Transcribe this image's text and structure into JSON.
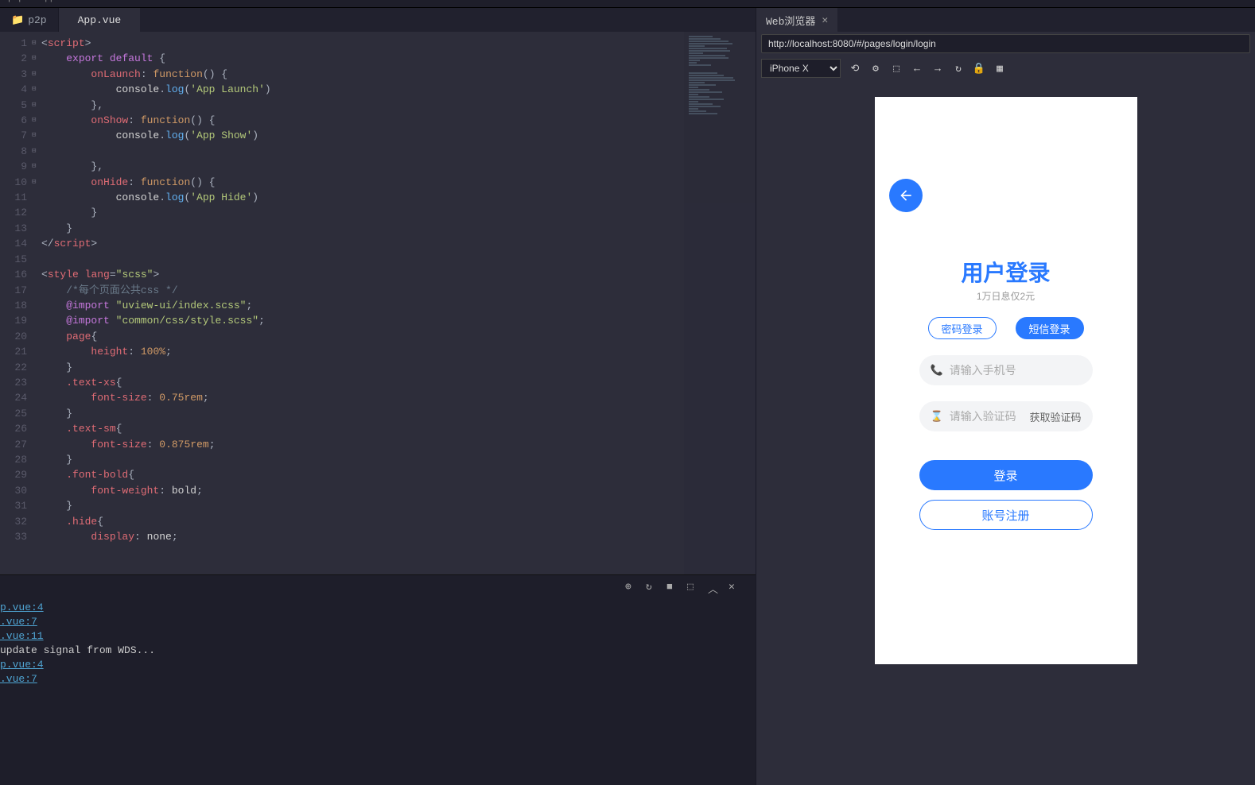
{
  "breadcrumb": {
    "folder": "p2p",
    "file": "App.vue"
  },
  "tabs": {
    "folder": "p2p",
    "file": "App.vue"
  },
  "code_lines": [
    "<span class='tk-pn'>&lt;</span><span class='tk-tag'>script</span><span class='tk-pn'>&gt;</span>",
    "    <span class='tk-key'>export</span> <span class='tk-key'>default</span> <span class='tk-pn'>{</span>",
    "        <span class='tk-attr'>onLaunch</span><span class='tk-pn'>:</span> <span class='tk-fn'>function</span><span class='tk-pn'>() {</span>",
    "            <span class='tk-val'>console</span><span class='tk-pn'>.</span><span class='tk-name'>log</span><span class='tk-pn'>(</span><span class='tk-str'>'App Launch'</span><span class='tk-pn'>)</span>",
    "        <span class='tk-pn'>},</span>",
    "        <span class='tk-attr'>onShow</span><span class='tk-pn'>:</span> <span class='tk-fn'>function</span><span class='tk-pn'>() {</span>",
    "            <span class='tk-val'>console</span><span class='tk-pn'>.</span><span class='tk-name'>log</span><span class='tk-pn'>(</span><span class='tk-str'>'App Show'</span><span class='tk-pn'>)</span>",
    "",
    "        <span class='tk-pn'>},</span>",
    "        <span class='tk-attr'>onHide</span><span class='tk-pn'>:</span> <span class='tk-fn'>function</span><span class='tk-pn'>() {</span>",
    "            <span class='tk-val'>console</span><span class='tk-pn'>.</span><span class='tk-name'>log</span><span class='tk-pn'>(</span><span class='tk-str'>'App Hide'</span><span class='tk-pn'>)</span>",
    "        <span class='tk-pn'>}</span>",
    "    <span class='tk-pn'>}</span>",
    "<span class='tk-pn'>&lt;/</span><span class='tk-tag'>script</span><span class='tk-pn'>&gt;</span>",
    "",
    "<span class='tk-pn'>&lt;</span><span class='tk-tag'>style</span> <span class='tk-attr'>lang</span><span class='tk-pn'>=</span><span class='tk-str'>\"scss\"</span><span class='tk-pn'>&gt;</span>",
    "    <span class='tk-cm'>/*每个页面公共css */</span>",
    "    <span class='tk-key'>@import</span> <span class='tk-str'>\"uview-ui/index.scss\"</span><span class='tk-pn'>;</span>",
    "    <span class='tk-key'>@import</span> <span class='tk-str'>\"common/css/style.scss\"</span><span class='tk-pn'>;</span>",
    "    <span class='tk-prop'>page</span><span class='tk-pn'>{</span>",
    "        <span class='tk-attr'>height</span><span class='tk-pn'>:</span> <span class='tk-num'>100%</span><span class='tk-pn'>;</span>",
    "    <span class='tk-pn'>}</span>",
    "    <span class='tk-prop'>.text-xs</span><span class='tk-pn'>{</span>",
    "        <span class='tk-attr'>font-size</span><span class='tk-pn'>:</span> <span class='tk-num'>0.75rem</span><span class='tk-pn'>;</span>",
    "    <span class='tk-pn'>}</span>",
    "    <span class='tk-prop'>.text-sm</span><span class='tk-pn'>{</span>",
    "        <span class='tk-attr'>font-size</span><span class='tk-pn'>:</span> <span class='tk-num'>0.875rem</span><span class='tk-pn'>;</span>",
    "    <span class='tk-pn'>}</span>",
    "    <span class='tk-prop'>.font-bold</span><span class='tk-pn'>{</span>",
    "        <span class='tk-attr'>font-weight</span><span class='tk-pn'>:</span> <span class='tk-val'>bold</span><span class='tk-pn'>;</span>",
    "    <span class='tk-pn'>}</span>",
    "    <span class='tk-prop'>.hide</span><span class='tk-pn'>{</span>",
    "        <span class='tk-attr'>display</span><span class='tk-pn'>:</span> <span class='tk-val'>none</span><span class='tk-pn'>;</span>"
  ],
  "fold_marks": [
    "",
    "⊟",
    "⊟",
    "",
    "",
    "⊟",
    "",
    "",
    "",
    "⊟",
    "",
    "",
    "",
    "",
    "",
    "⊟",
    "",
    "",
    "",
    "⊟",
    "",
    "",
    "⊟",
    "",
    "",
    "⊟",
    "",
    "",
    "⊟",
    "",
    "",
    "⊟",
    ""
  ],
  "console": {
    "links": [
      "p.vue:4",
      ".vue:7",
      ".vue:11"
    ],
    "text": " update signal from WDS...",
    "links2": [
      "p.vue:4",
      ".vue:7"
    ]
  },
  "browser": {
    "tab": "Web浏览器",
    "url": "http://localhost:8080/#/pages/login/login",
    "device": "iPhone X"
  },
  "preview": {
    "title": "用户登录",
    "subtitle": "1万日息仅2元",
    "tab_pwd": "密码登录",
    "tab_sms": "短信登录",
    "phone_placeholder": "请输入手机号",
    "code_placeholder": "请输入验证码",
    "code_action": "获取验证码",
    "login_btn": "登录",
    "register_btn": "账号注册"
  }
}
